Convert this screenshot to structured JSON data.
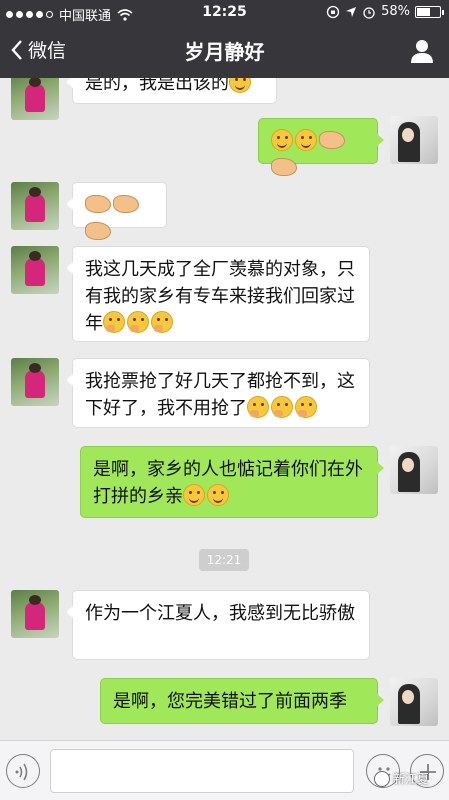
{
  "status_bar": {
    "carrier": "中国联通",
    "time": "12:25",
    "battery_text": "58%",
    "battery_level": 0.58
  },
  "nav": {
    "back_label": "微信",
    "title": "岁月静好"
  },
  "messages": [
    {
      "side": "left",
      "text": "是的，我是出该的",
      "emoji": [
        "smile"
      ]
    },
    {
      "side": "right",
      "text": "",
      "emoji": [
        "smile",
        "smile",
        "hand",
        "hand"
      ]
    },
    {
      "side": "left",
      "text": "",
      "emoji": [
        "hand",
        "hand",
        "hand"
      ]
    },
    {
      "side": "left",
      "text": "我这几天成了全厂羡慕的对象，只有我的家乡有专车来接我们回家过年",
      "emoji": [
        "think",
        "think",
        "think"
      ]
    },
    {
      "side": "left",
      "text": "我抢票抢了好几天了都抢不到，这下好了，我不用抢了",
      "emoji": [
        "think",
        "think",
        "think"
      ]
    },
    {
      "side": "right",
      "text": "是啊，家乡的人也惦记着你们在外打拼的乡亲",
      "emoji": [
        "smile",
        "smile"
      ]
    },
    {
      "side": "left",
      "text": "作为一个江夏人，我感到无比骄傲",
      "emoji": []
    },
    {
      "side": "right",
      "text": "是啊，您完美错过了前面两季",
      "emoji": []
    }
  ],
  "timestamp_chip": "12:21",
  "input": {
    "value": "",
    "placeholder": ""
  },
  "watermark": "新江夏",
  "colors": {
    "nav_bg": "#37363b",
    "chat_bg": "#ebebeb",
    "green_bubble": "#a0e75a"
  }
}
